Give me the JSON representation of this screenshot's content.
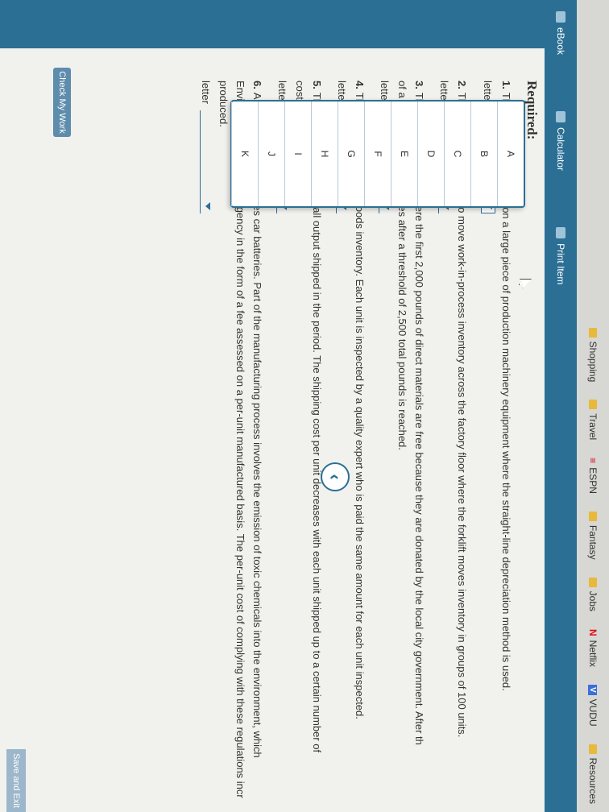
{
  "bookmarks": [
    {
      "label": "Shopping",
      "icon": "folder-icon"
    },
    {
      "label": "Travel",
      "icon": "folder-icon"
    },
    {
      "label": "ESPN",
      "icon": "espn-icon"
    },
    {
      "label": "Fantasy",
      "icon": "folder-icon"
    },
    {
      "label": "Jobs",
      "icon": "folder-icon"
    },
    {
      "label": "Netflix",
      "icon": "netflix-icon"
    },
    {
      "label": "VUDU",
      "icon": "vudu-icon"
    },
    {
      "label": "Resources",
      "icon": "folder-icon"
    }
  ],
  "toolbar": {
    "ebook": "eBook",
    "calculator": "Calculator",
    "print_item": "Print Item"
  },
  "heading": "Required:",
  "answer_label": "letter",
  "questions": [
    {
      "num": "1.",
      "text": "The cost of depreciation on a large piece of production machinery equipment where the straight-line depreciation method is used."
    },
    {
      "num": "2.",
      "text": "The cost of o          g a forklift to move work-in-process inventory across the factory floor where the forklift moves inventory in groups of 100 units."
    },
    {
      "num": "3.",
      "text": "The cost of d          aterials where the first 2,000 pounds of direct materials are free because they are donated by the local city government. After th",
      "text2": "of a per-unit am          at decreases after a threshold of 2,500 total pounds is reached."
    },
    {
      "num": "4.",
      "text": "The cost of i          g finished goods inventory. Each unit is inspected by a quality expert who is paid the same amount for each unit inspected."
    },
    {
      "num": "5.",
      "text": "The cost of s          hipping for all output shipped in the period. The shipping cost per unit decreases with each unit shipped up to a certain number of",
      "text2": "cost per unit re          nstant."
    },
    {
      "num": "6.",
      "text": "An electric c          manufactures car batteries. Part of the manufacturing process involves the emission of toxic chemicals into the environment, which",
      "text2": "Environmental Protection Agency in the form of a fee assessed on a per-unit manufactured basis. The per-unit cost of complying with these regulations incr",
      "text3": "produced."
    }
  ],
  "dropdown_options": [
    "A",
    "B",
    "C",
    "D",
    "E",
    "F",
    "G",
    "H",
    "I",
    "J",
    "K"
  ],
  "buttons": {
    "check_my_work": "Check My Work",
    "save_and_exit": "Save and Exit"
  },
  "colors": {
    "toolbar_bg": "#2b6f95",
    "accent": "#2b6f95"
  }
}
